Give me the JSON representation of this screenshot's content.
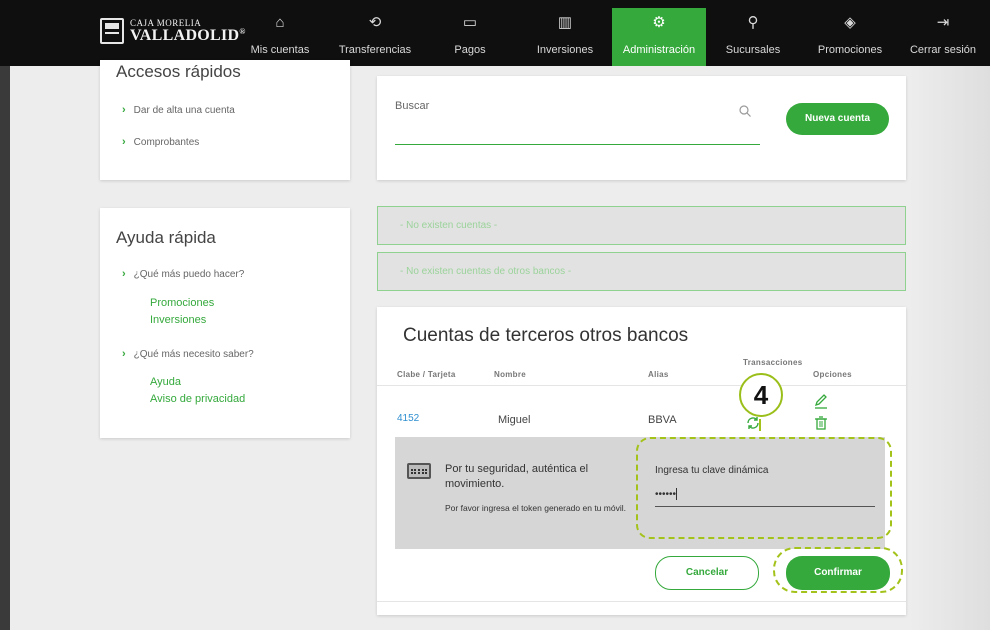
{
  "brand": {
    "line1": "CAJA MORELIA",
    "line2": "VALLADOLID",
    "registered": "®"
  },
  "nav": [
    {
      "label": "Mis cuentas",
      "icon": "home-icon",
      "glyph": "⌂"
    },
    {
      "label": "Transferencias",
      "icon": "transfer-icon",
      "glyph": "⟲"
    },
    {
      "label": "Pagos",
      "icon": "payments-icon",
      "glyph": "▭"
    },
    {
      "label": "Inversiones",
      "icon": "investments-icon",
      "glyph": "▥"
    },
    {
      "label": "Administración",
      "icon": "gear-icon",
      "glyph": "⚙",
      "active": true
    },
    {
      "label": "Sucursales",
      "icon": "location-pin-icon",
      "glyph": "⚲"
    },
    {
      "label": "Promociones",
      "icon": "tag-icon",
      "glyph": "◈"
    },
    {
      "label": "Cerrar sesión",
      "icon": "logout-icon",
      "glyph": "⇥"
    }
  ],
  "quick_access": {
    "title": "Accesos rápidos",
    "links": [
      "Dar de alta una cuenta",
      "Comprobantes"
    ]
  },
  "quick_help": {
    "title": "Ayuda rápida",
    "q1": "¿Qué más puedo hacer?",
    "q1_links": [
      "Promociones",
      "Inversiones"
    ],
    "q2": "¿Qué más necesito saber?",
    "q2_links": [
      "Ayuda",
      "Aviso de privacidad"
    ]
  },
  "search": {
    "label": "Buscar",
    "new_account": "Nueva cuenta"
  },
  "notices": [
    "- No existen cuentas -",
    "- No existen cuentas de otros bancos -"
  ],
  "third_party": {
    "title": "Cuentas de terceros otros bancos",
    "headers": {
      "clabe": "Clabe / Tarjeta",
      "nombre": "Nombre",
      "alias": "Alias",
      "transacciones": "Transacciones",
      "opciones": "Opciones"
    },
    "row": {
      "clabe": "4152",
      "nombre": "Miguel",
      "alias": "BBVA"
    }
  },
  "token": {
    "security_text": "Por tu seguridad, auténtica el movimiento.",
    "instruction": "Por favor ingresa el token generado en tu móvil.",
    "input_label": "Ingresa tu clave dinámica",
    "input_value": "••••••"
  },
  "buttons": {
    "cancel": "Cancelar",
    "confirm": "Confirmar"
  },
  "step_badge": "4",
  "colors": {
    "brand_green": "#35a93c",
    "highlight": "#a3c21a",
    "nav_bg": "#0f0f0f"
  }
}
